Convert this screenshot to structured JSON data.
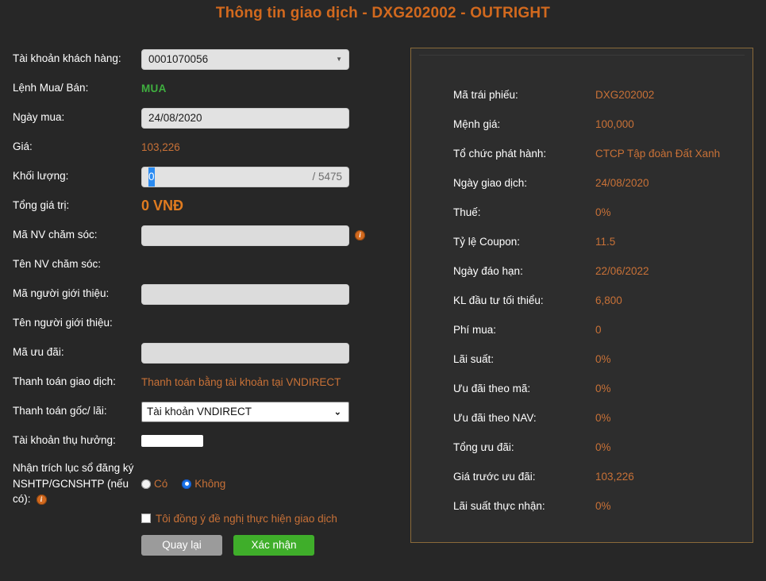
{
  "header": {
    "title": "Thông tin giao dịch - DXG202002 - OUTRIGHT",
    "accent": "#d2691e"
  },
  "form": {
    "rows": {
      "account": {
        "label": "Tài khoản khách hàng:",
        "value": "0001070056",
        "caret": "▼"
      },
      "order_side": {
        "label": "Lệnh Mua/ Bán:",
        "value": "MUA",
        "color": "#3faf3f"
      },
      "buy_date": {
        "label": "Ngày mua:",
        "value": "24/08/2020"
      },
      "price": {
        "label": "Giá:",
        "value": "103,226"
      },
      "quantity": {
        "label": "Khối lượng:",
        "value": "0",
        "max_suffix": "/ 5475"
      },
      "total_value": {
        "label": "Tổng giá trị:",
        "value": "0 VNĐ"
      },
      "care_staff_code": {
        "label": "Mã NV chăm sóc:",
        "value": "",
        "info_icon": "i"
      },
      "care_staff_name": {
        "label": "Tên NV chăm sóc:",
        "value": ""
      },
      "referrer_code": {
        "label": "Mã người giới thiệu:",
        "value": ""
      },
      "referrer_name": {
        "label": "Tên người giới thiệu:",
        "value": ""
      },
      "promo_code": {
        "label": "Mã ưu đãi:",
        "value": ""
      },
      "payment_method": {
        "label": "Thanh toán giao dịch:",
        "value": "Thanh toán bằng tài khoản tại VNDIRECT"
      },
      "principal_interest_payment": {
        "label": "Thanh toán gốc/ lãi:",
        "value": "Tài khoản VNDIRECT",
        "options": [
          "Tài khoản VNDIRECT"
        ],
        "caret": "⌄"
      },
      "beneficiary_account": {
        "label": "Tài khoản thụ hưởng:",
        "value": ""
      },
      "register_extract": {
        "label_line1": "Nhận trích lục sổ đăng ký",
        "label_line2": "NSHTP/GCNSHTP (nếu có):",
        "info_icon": "i",
        "options": [
          {
            "label": "Có",
            "selected": false
          },
          {
            "label": "Không",
            "selected": true
          }
        ]
      }
    },
    "agree": {
      "label": "Tôi đồng ý đề nghị thực hiện giao dịch",
      "checked": false
    },
    "buttons": {
      "back": "Quay lại",
      "confirm": "Xác nhận"
    }
  },
  "panel": {
    "rows": [
      {
        "label": "Mã trái phiếu:",
        "value": "DXG202002"
      },
      {
        "label": "Mệnh giá:",
        "value": "100,000"
      },
      {
        "label": "Tổ chức phát hành:",
        "value": "CTCP Tập đoàn Đất Xanh"
      },
      {
        "label": "Ngày giao dịch:",
        "value": "24/08/2020"
      },
      {
        "label": "Thuế:",
        "value": "0%"
      },
      {
        "label": "Tỷ lệ Coupon:",
        "value": "11.5"
      },
      {
        "label": "Ngày đáo hạn:",
        "value": "22/06/2022"
      },
      {
        "label": "KL đầu tư tối thiểu:",
        "value": "6,800"
      },
      {
        "label": "Phí mua:",
        "value": "0"
      },
      {
        "label": "Lãi suất:",
        "value": "0%"
      },
      {
        "label": "Ưu đãi theo mã:",
        "value": "0%"
      },
      {
        "label": "Ưu đãi theo NAV:",
        "value": "0%"
      },
      {
        "label": "Tổng ưu đãi:",
        "value": "0%"
      },
      {
        "label": "Giá trước ưu đãi:",
        "value": "103,226"
      },
      {
        "label": "Lãi suất thực nhận:",
        "value": "0%"
      }
    ]
  }
}
